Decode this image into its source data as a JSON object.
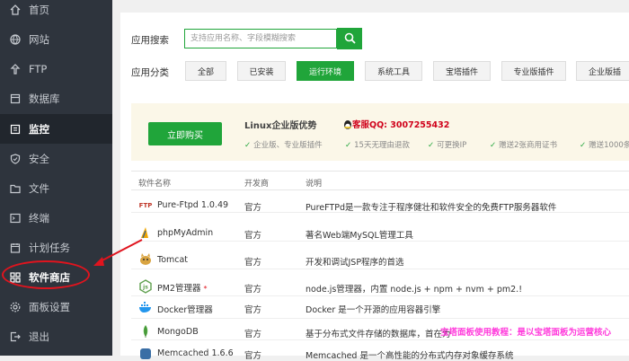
{
  "sidebar": {
    "items": [
      {
        "label": "首页",
        "icon": "home-icon"
      },
      {
        "label": "网站",
        "icon": "globe-icon"
      },
      {
        "label": "FTP",
        "icon": "ftp-icon"
      },
      {
        "label": "数据库",
        "icon": "database-icon"
      },
      {
        "label": "监控",
        "icon": "monitor-icon"
      },
      {
        "label": "安全",
        "icon": "shield-icon"
      },
      {
        "label": "文件",
        "icon": "folder-icon"
      },
      {
        "label": "终端",
        "icon": "terminal-icon"
      },
      {
        "label": "计划任务",
        "icon": "calendar-icon"
      },
      {
        "label": "软件商店",
        "icon": "grid-icon"
      },
      {
        "label": "面板设置",
        "icon": "settings-icon"
      },
      {
        "label": "退出",
        "icon": "logout-icon"
      }
    ]
  },
  "search": {
    "label": "应用搜索",
    "placeholder": "支持应用名称、字段模糊搜索"
  },
  "categories": {
    "label": "应用分类",
    "items": [
      "全部",
      "已安装",
      "运行环境",
      "系统工具",
      "宝塔插件",
      "专业版插件",
      "企业版插"
    ],
    "active": "运行环境"
  },
  "promo": {
    "buy_label": "立即购买",
    "title": "Linux企业版优势",
    "qq": "客服QQ: 3007255432",
    "features": [
      "企业版、专业版插件",
      "15天无理由退款",
      "可更换IP",
      "赠送2张商用证书",
      "赠送1000条"
    ]
  },
  "table": {
    "headers": [
      "软件名称",
      "开发商",
      "说明"
    ],
    "rows": [
      {
        "name": "Pure-Ftpd 1.0.49",
        "dev": "官方",
        "desc": "PureFTPd是一款专注于程序健壮和软件安全的免费FTP服务器软件",
        "icon": "pure-ftpd-icon"
      },
      {
        "name": "phpMyAdmin",
        "dev": "官方",
        "desc": "著名Web端MySQL管理工具",
        "icon": "phpmyadmin-icon"
      },
      {
        "name": "Tomcat",
        "dev": "官方",
        "desc": "开发和调试JSP程序的首选",
        "icon": "tomcat-icon"
      },
      {
        "name": "PM2管理器",
        "dev": "官方",
        "desc": "node.js管理器，内置 node.js + npm + nvm + pm2.!",
        "icon": "pm2-icon"
      },
      {
        "name": "Docker管理器",
        "dev": "官方",
        "desc": "Docker 是一个开源的应用容器引擎",
        "icon": "docker-icon"
      },
      {
        "name": "MongoDB",
        "dev": "官方",
        "desc": "基于分布式文件存储的数据库，首在为",
        "icon": "mongodb-icon"
      },
      {
        "name": "Memcached 1.6.6",
        "dev": "官方",
        "desc": "Memcached 是一个高性能的分布式内存对象缓存系统",
        "icon": "memcached-icon"
      }
    ]
  },
  "watermark": "宝塔面板使用教程：是以宝塔面板为运营核心",
  "colors": {
    "accent": "#20a53a",
    "sidebar": "#2e343d",
    "annotation": "#e0141e"
  }
}
